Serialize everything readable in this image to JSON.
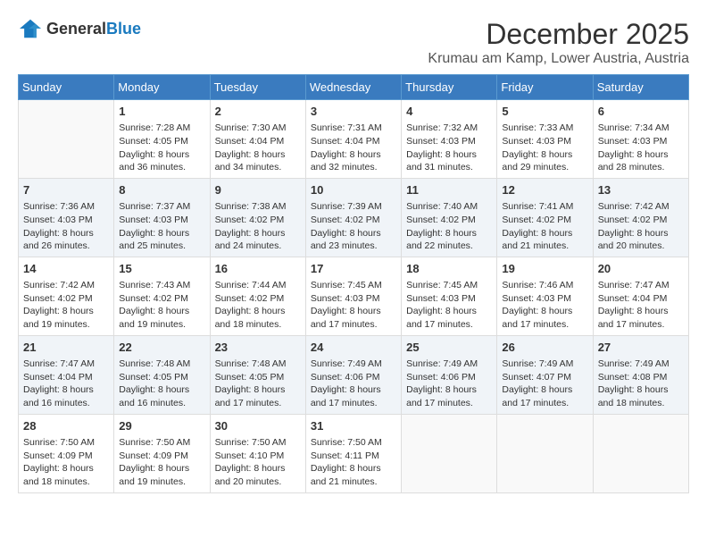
{
  "header": {
    "logo_general": "General",
    "logo_blue": "Blue",
    "month": "December 2025",
    "location": "Krumau am Kamp, Lower Austria, Austria"
  },
  "weekdays": [
    "Sunday",
    "Monday",
    "Tuesday",
    "Wednesday",
    "Thursday",
    "Friday",
    "Saturday"
  ],
  "weeks": [
    [
      {
        "day": "",
        "sunrise": "",
        "sunset": "",
        "daylight": ""
      },
      {
        "day": "1",
        "sunrise": "Sunrise: 7:28 AM",
        "sunset": "Sunset: 4:05 PM",
        "daylight": "Daylight: 8 hours and 36 minutes."
      },
      {
        "day": "2",
        "sunrise": "Sunrise: 7:30 AM",
        "sunset": "Sunset: 4:04 PM",
        "daylight": "Daylight: 8 hours and 34 minutes."
      },
      {
        "day": "3",
        "sunrise": "Sunrise: 7:31 AM",
        "sunset": "Sunset: 4:04 PM",
        "daylight": "Daylight: 8 hours and 32 minutes."
      },
      {
        "day": "4",
        "sunrise": "Sunrise: 7:32 AM",
        "sunset": "Sunset: 4:03 PM",
        "daylight": "Daylight: 8 hours and 31 minutes."
      },
      {
        "day": "5",
        "sunrise": "Sunrise: 7:33 AM",
        "sunset": "Sunset: 4:03 PM",
        "daylight": "Daylight: 8 hours and 29 minutes."
      },
      {
        "day": "6",
        "sunrise": "Sunrise: 7:34 AM",
        "sunset": "Sunset: 4:03 PM",
        "daylight": "Daylight: 8 hours and 28 minutes."
      }
    ],
    [
      {
        "day": "7",
        "sunrise": "Sunrise: 7:36 AM",
        "sunset": "Sunset: 4:03 PM",
        "daylight": "Daylight: 8 hours and 26 minutes."
      },
      {
        "day": "8",
        "sunrise": "Sunrise: 7:37 AM",
        "sunset": "Sunset: 4:03 PM",
        "daylight": "Daylight: 8 hours and 25 minutes."
      },
      {
        "day": "9",
        "sunrise": "Sunrise: 7:38 AM",
        "sunset": "Sunset: 4:02 PM",
        "daylight": "Daylight: 8 hours and 24 minutes."
      },
      {
        "day": "10",
        "sunrise": "Sunrise: 7:39 AM",
        "sunset": "Sunset: 4:02 PM",
        "daylight": "Daylight: 8 hours and 23 minutes."
      },
      {
        "day": "11",
        "sunrise": "Sunrise: 7:40 AM",
        "sunset": "Sunset: 4:02 PM",
        "daylight": "Daylight: 8 hours and 22 minutes."
      },
      {
        "day": "12",
        "sunrise": "Sunrise: 7:41 AM",
        "sunset": "Sunset: 4:02 PM",
        "daylight": "Daylight: 8 hours and 21 minutes."
      },
      {
        "day": "13",
        "sunrise": "Sunrise: 7:42 AM",
        "sunset": "Sunset: 4:02 PM",
        "daylight": "Daylight: 8 hours and 20 minutes."
      }
    ],
    [
      {
        "day": "14",
        "sunrise": "Sunrise: 7:42 AM",
        "sunset": "Sunset: 4:02 PM",
        "daylight": "Daylight: 8 hours and 19 minutes."
      },
      {
        "day": "15",
        "sunrise": "Sunrise: 7:43 AM",
        "sunset": "Sunset: 4:02 PM",
        "daylight": "Daylight: 8 hours and 19 minutes."
      },
      {
        "day": "16",
        "sunrise": "Sunrise: 7:44 AM",
        "sunset": "Sunset: 4:02 PM",
        "daylight": "Daylight: 8 hours and 18 minutes."
      },
      {
        "day": "17",
        "sunrise": "Sunrise: 7:45 AM",
        "sunset": "Sunset: 4:03 PM",
        "daylight": "Daylight: 8 hours and 17 minutes."
      },
      {
        "day": "18",
        "sunrise": "Sunrise: 7:45 AM",
        "sunset": "Sunset: 4:03 PM",
        "daylight": "Daylight: 8 hours and 17 minutes."
      },
      {
        "day": "19",
        "sunrise": "Sunrise: 7:46 AM",
        "sunset": "Sunset: 4:03 PM",
        "daylight": "Daylight: 8 hours and 17 minutes."
      },
      {
        "day": "20",
        "sunrise": "Sunrise: 7:47 AM",
        "sunset": "Sunset: 4:04 PM",
        "daylight": "Daylight: 8 hours and 17 minutes."
      }
    ],
    [
      {
        "day": "21",
        "sunrise": "Sunrise: 7:47 AM",
        "sunset": "Sunset: 4:04 PM",
        "daylight": "Daylight: 8 hours and 16 minutes."
      },
      {
        "day": "22",
        "sunrise": "Sunrise: 7:48 AM",
        "sunset": "Sunset: 4:05 PM",
        "daylight": "Daylight: 8 hours and 16 minutes."
      },
      {
        "day": "23",
        "sunrise": "Sunrise: 7:48 AM",
        "sunset": "Sunset: 4:05 PM",
        "daylight": "Daylight: 8 hours and 17 minutes."
      },
      {
        "day": "24",
        "sunrise": "Sunrise: 7:49 AM",
        "sunset": "Sunset: 4:06 PM",
        "daylight": "Daylight: 8 hours and 17 minutes."
      },
      {
        "day": "25",
        "sunrise": "Sunrise: 7:49 AM",
        "sunset": "Sunset: 4:06 PM",
        "daylight": "Daylight: 8 hours and 17 minutes."
      },
      {
        "day": "26",
        "sunrise": "Sunrise: 7:49 AM",
        "sunset": "Sunset: 4:07 PM",
        "daylight": "Daylight: 8 hours and 17 minutes."
      },
      {
        "day": "27",
        "sunrise": "Sunrise: 7:49 AM",
        "sunset": "Sunset: 4:08 PM",
        "daylight": "Daylight: 8 hours and 18 minutes."
      }
    ],
    [
      {
        "day": "28",
        "sunrise": "Sunrise: 7:50 AM",
        "sunset": "Sunset: 4:09 PM",
        "daylight": "Daylight: 8 hours and 18 minutes."
      },
      {
        "day": "29",
        "sunrise": "Sunrise: 7:50 AM",
        "sunset": "Sunset: 4:09 PM",
        "daylight": "Daylight: 8 hours and 19 minutes."
      },
      {
        "day": "30",
        "sunrise": "Sunrise: 7:50 AM",
        "sunset": "Sunset: 4:10 PM",
        "daylight": "Daylight: 8 hours and 20 minutes."
      },
      {
        "day": "31",
        "sunrise": "Sunrise: 7:50 AM",
        "sunset": "Sunset: 4:11 PM",
        "daylight": "Daylight: 8 hours and 21 minutes."
      },
      {
        "day": "",
        "sunrise": "",
        "sunset": "",
        "daylight": ""
      },
      {
        "day": "",
        "sunrise": "",
        "sunset": "",
        "daylight": ""
      },
      {
        "day": "",
        "sunrise": "",
        "sunset": "",
        "daylight": ""
      }
    ]
  ]
}
